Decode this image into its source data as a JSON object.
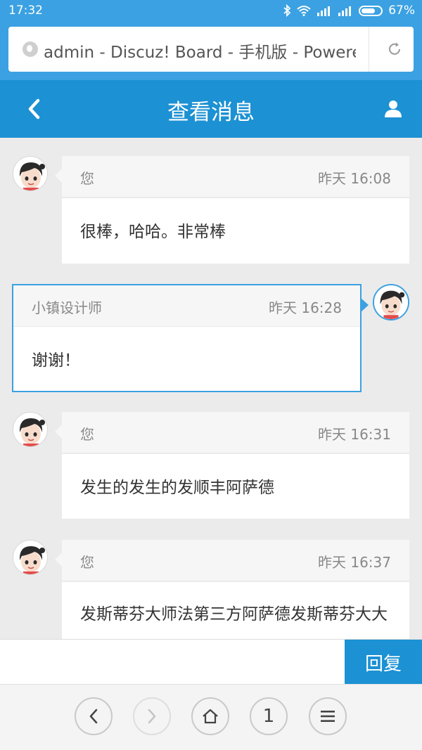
{
  "status_bar": {
    "time": "17:32",
    "battery_percent": "67%"
  },
  "browser": {
    "url_text": "admin - Discuz! Board - 手机版 - Powered by Discuz!"
  },
  "header": {
    "title": "查看消息"
  },
  "messages": [
    {
      "sender": "您",
      "time": "昨天 16:08",
      "text": "很棒，哈哈。非常棒",
      "side": "left"
    },
    {
      "sender": "小镇设计师",
      "time": "昨天 16:28",
      "text": "谢谢！",
      "side": "right"
    },
    {
      "sender": "您",
      "time": "昨天 16:31",
      "text": "发生的发生的发顺丰阿萨德",
      "side": "left"
    },
    {
      "sender": "您",
      "time": "昨天 16:37",
      "text": "发斯蒂芬大师法第三方阿萨德发斯蒂芬大大",
      "side": "left"
    }
  ],
  "reply": {
    "placeholder": "",
    "button_label": "回复"
  },
  "bottom_nav": {
    "page_number": "1"
  },
  "colors": {
    "accent": "#1c91d3",
    "statusbar": "#3ba1e2",
    "background": "#ebebeb"
  }
}
